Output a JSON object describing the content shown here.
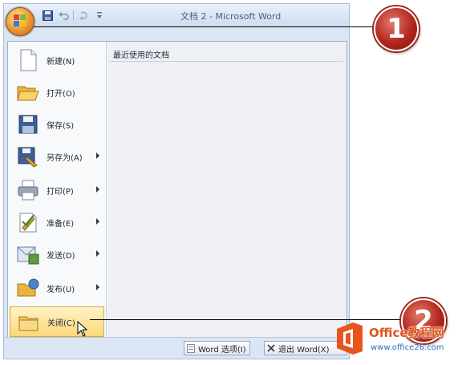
{
  "window": {
    "title": "文档 2 - Microsoft Word"
  },
  "quick_access": {
    "items": [
      "save-icon",
      "undo-icon",
      "redo-icon",
      "customize-icon"
    ],
    "separator": "|"
  },
  "menu": {
    "commands": [
      {
        "label": "新建(N)",
        "icon": "new-document-icon",
        "submenu": false
      },
      {
        "label": "打开(O)",
        "icon": "open-folder-icon",
        "submenu": false
      },
      {
        "label": "保存(S)",
        "icon": "save-disk-icon",
        "submenu": false
      },
      {
        "label": "另存为(A)",
        "icon": "save-as-icon",
        "submenu": true
      },
      {
        "label": "打印(P)",
        "icon": "printer-icon",
        "submenu": true
      },
      {
        "label": "准备(E)",
        "icon": "prepare-icon",
        "submenu": true
      },
      {
        "label": "发送(D)",
        "icon": "send-icon",
        "submenu": true
      },
      {
        "label": "发布(U)",
        "icon": "publish-icon",
        "submenu": true
      },
      {
        "label": "关闭(C)",
        "icon": "close-folder-icon",
        "submenu": false,
        "highlighted": true
      }
    ],
    "recent_title": "最近使用的文档",
    "word_options_label": "Word 选项(I)",
    "exit_word_label": "退出 Word(X)"
  },
  "callouts": {
    "first": "1",
    "second": "2"
  },
  "watermark": {
    "brand": "Office教程网",
    "url": "www.office26.com"
  },
  "colors": {
    "highlight": "#fbd77a",
    "callout": "#b3261d",
    "brand_orange": "#e0561b"
  }
}
